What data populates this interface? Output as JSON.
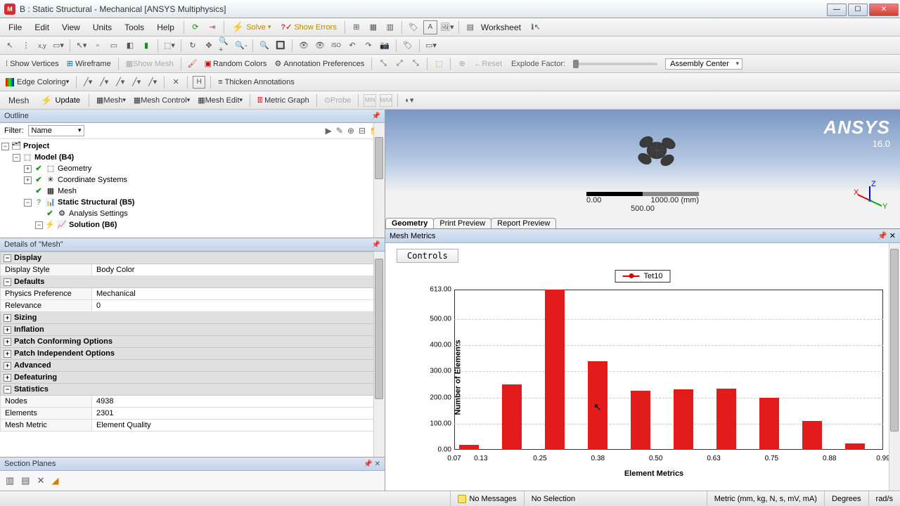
{
  "window": {
    "title": "B : Static Structural - Mechanical [ANSYS Multiphysics]"
  },
  "menu": {
    "file": "File",
    "edit": "Edit",
    "view": "View",
    "units": "Units",
    "tools": "Tools",
    "help": "Help",
    "solve": "Solve",
    "show_errors": "Show Errors",
    "worksheet": "Worksheet"
  },
  "tb2": {
    "show_vertices": "Show Vertices",
    "wireframe": "Wireframe",
    "show_mesh": "Show Mesh",
    "random_colors": "Random Colors",
    "annotation_prefs": "Annotation Preferences",
    "reset": "Reset",
    "explode": "Explode Factor:",
    "assembly_center": "Assembly Center"
  },
  "tb3": {
    "edge_coloring": "Edge Coloring",
    "thicken": "Thicken Annotations"
  },
  "tb4": {
    "mesh": "Mesh",
    "update": "Update",
    "mesh_dd": "Mesh",
    "mesh_control": "Mesh Control",
    "mesh_edit": "Mesh Edit",
    "metric_graph": "Metric Graph",
    "probe": "Probe"
  },
  "outline": {
    "title": "Outline",
    "filter_label": "Filter:",
    "filter_value": "Name",
    "tree": {
      "project": "Project",
      "model": "Model (B4)",
      "geometry": "Geometry",
      "coord": "Coordinate Systems",
      "mesh": "Mesh",
      "static": "Static Structural (B5)",
      "analysis": "Analysis Settings",
      "solution": "Solution (B6)"
    }
  },
  "details": {
    "title": "Details of \"Mesh\"",
    "sections": {
      "display": "Display",
      "defaults": "Defaults",
      "sizing": "Sizing",
      "inflation": "Inflation",
      "patch_conf": "Patch Conforming Options",
      "patch_ind": "Patch Independent Options",
      "advanced": "Advanced",
      "defeaturing": "Defeaturing",
      "statistics": "Statistics"
    },
    "rows": {
      "display_style_k": "Display Style",
      "display_style_v": "Body Color",
      "physics_k": "Physics Preference",
      "physics_v": "Mechanical",
      "relevance_k": "Relevance",
      "relevance_v": "0",
      "nodes_k": "Nodes",
      "nodes_v": "4938",
      "elements_k": "Elements",
      "elements_v": "2301",
      "mesh_metric_k": "Mesh Metric",
      "mesh_metric_v": "Element Quality"
    }
  },
  "section_planes": {
    "title": "Section Planes"
  },
  "viewport": {
    "logo": "ANSYS",
    "version": "16.0",
    "scale_min": "0.00",
    "scale_mid": "500.00",
    "scale_max": "1000.00 (mm)",
    "tabs": {
      "geometry": "Geometry",
      "print": "Print Preview",
      "report": "Report Preview"
    }
  },
  "metrics": {
    "title": "Mesh Metrics",
    "controls": "Controls",
    "legend": "Tet10",
    "ylabel": "Number of Elements",
    "xlabel": "Element Metrics"
  },
  "chart_data": {
    "type": "bar",
    "title": "",
    "xlabel": "Element Metrics",
    "ylabel": "Number of Elements",
    "legend": [
      "Tet10"
    ],
    "ylim": [
      0,
      613
    ],
    "yticks": [
      0,
      100,
      200,
      300,
      400,
      500,
      613
    ],
    "ytick_labels": [
      "0.00",
      "100.00",
      "200.00",
      "300.00",
      "400.00",
      "500.00",
      "613.00"
    ],
    "categories": [
      "0.07",
      "0.13",
      "0.25",
      "0.38",
      "0.50",
      "0.63",
      "0.75",
      "0.88",
      "0.99"
    ],
    "xtick_positions": [
      0.0,
      0.062,
      0.2,
      0.335,
      0.47,
      0.605,
      0.74,
      0.875,
      1.0
    ],
    "bars": [
      {
        "x": 0.035,
        "value": 20
      },
      {
        "x": 0.135,
        "value": 250
      },
      {
        "x": 0.235,
        "value": 613
      },
      {
        "x": 0.335,
        "value": 340
      },
      {
        "x": 0.435,
        "value": 225
      },
      {
        "x": 0.535,
        "value": 230
      },
      {
        "x": 0.635,
        "value": 235
      },
      {
        "x": 0.735,
        "value": 200
      },
      {
        "x": 0.835,
        "value": 110
      },
      {
        "x": 0.935,
        "value": 25
      }
    ]
  },
  "status": {
    "no_messages": "No Messages",
    "no_selection": "No Selection",
    "units": "Metric (mm, kg, N, s, mV, mA)",
    "degrees": "Degrees",
    "rads": "rad/s"
  }
}
